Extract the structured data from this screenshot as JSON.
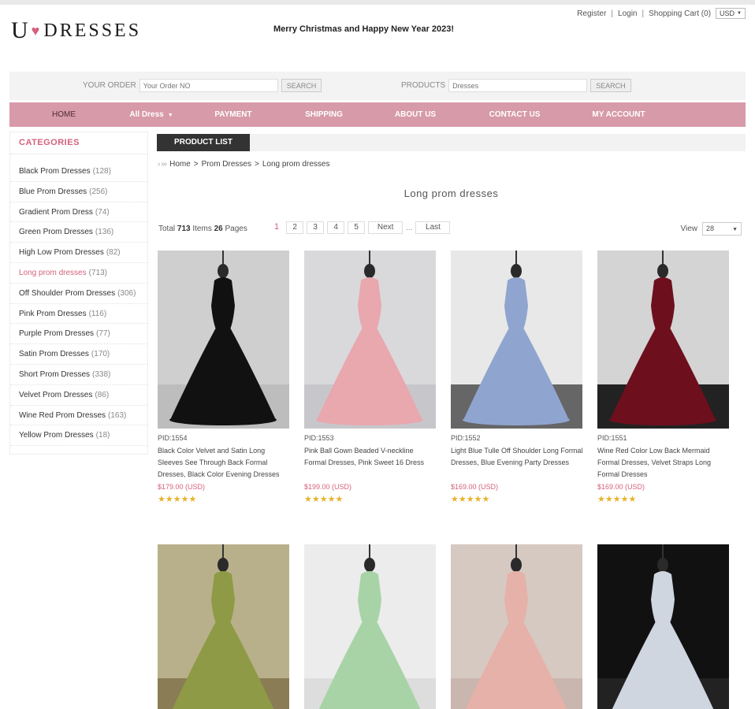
{
  "brand": {
    "logo_first": "U",
    "logo_heart": "♥",
    "logo_rest": "DRESSES"
  },
  "greeting": "Merry Christmas and Happy New Year 2023!",
  "toplinks": {
    "register": "Register",
    "login": "Login",
    "cart": "Shopping Cart (0)",
    "currency": "USD",
    "separator": "|"
  },
  "search": {
    "order_label": "YOUR ORDER",
    "order_placeholder": "Your Order NO",
    "order_button": "SEARCH",
    "products_label": "PRODUCTS",
    "products_placeholder": "Dresses",
    "products_button": "SEARCH"
  },
  "nav": [
    {
      "label": "HOME",
      "active": true
    },
    {
      "label": "All Dress",
      "dropdown": true
    },
    {
      "label": "PAYMENT"
    },
    {
      "label": "SHIPPING"
    },
    {
      "label": "ABOUT US"
    },
    {
      "label": "CONTACT US"
    },
    {
      "label": "MY ACCOUNT"
    }
  ],
  "sidebar": {
    "title": "CATEGORIES",
    "items": [
      {
        "name": "Black Prom Dresses",
        "count": "(128)"
      },
      {
        "name": "Blue Prom Dresses",
        "count": "(256)"
      },
      {
        "name": "Gradient Prom Dress",
        "count": "(74)"
      },
      {
        "name": "Green Prom Dresses",
        "count": "(136)"
      },
      {
        "name": "High Low Prom Dresses",
        "count": "(82)"
      },
      {
        "name": "Long prom dresses",
        "count": "(713)",
        "active": true
      },
      {
        "name": "Off Shoulder Prom Dresses",
        "count": "(306)"
      },
      {
        "name": "Pink Prom Dresses",
        "count": "(116)"
      },
      {
        "name": "Purple Prom Dresses",
        "count": "(77)"
      },
      {
        "name": "Satin Prom Dresses",
        "count": "(170)"
      },
      {
        "name": "Short Prom Dresses",
        "count": "(338)"
      },
      {
        "name": "Velvet Prom Dresses",
        "count": "(86)"
      },
      {
        "name": "Wine Red Prom Dresses",
        "count": "(163)"
      },
      {
        "name": "Yellow Prom Dresses",
        "count": "(18)"
      }
    ]
  },
  "tab": "PRODUCT LIST",
  "breadcrumb": {
    "arrows": "› ›››",
    "home": "Home",
    "sep": ">",
    "category": "Prom Dresses",
    "current": "Long prom dresses"
  },
  "page_title": "Long prom dresses",
  "listing": {
    "total_label": "Total",
    "total_items": "713",
    "items_label": "Items",
    "total_pages": "26",
    "pages_label": "Pages",
    "view_label": "View",
    "view_value": "28"
  },
  "pagination": {
    "current": "1",
    "pages": [
      "2",
      "3",
      "4",
      "5"
    ],
    "next": "Next",
    "dots": "...",
    "last": "Last"
  },
  "stars_text": "★★★★★",
  "products": [
    {
      "pid": "PID:1554",
      "title": "Black Color Velvet and Satin Long Sleeves See Through Back Formal Dresses, Black Color Evening Dresses",
      "price": "$179.00 (USD)",
      "dress": "#111111",
      "bg": "#cfcfcf",
      "floor": "#bdbdbd"
    },
    {
      "pid": "PID:1553",
      "title": "Pink Ball Gown Beaded V-neckline Formal Dresses, Pink Sweet 16 Dress",
      "price": "$199.00 (USD)",
      "dress": "#e9a7ae",
      "bg": "#d9d9dc",
      "floor": "#c7c7cb"
    },
    {
      "pid": "PID:1552",
      "title": "Light Blue Tulle Off Shoulder Long Formal Dresses, Blue Evening Party Dresses",
      "price": "$169.00 (USD)",
      "dress": "#8fa5cf",
      "bg": "#e8e8e8",
      "floor": "#666666"
    },
    {
      "pid": "PID:1551",
      "title": "Wine Red Color Low Back Mermaid Formal Dresses, Velvet Straps Long Formal Dresses",
      "price": "$169.00 (USD)",
      "dress": "#6e0f1e",
      "bg": "#d4d4d4",
      "floor": "#222222"
    },
    {
      "dress": "#8e9a45",
      "bg": "#b8b08a",
      "floor": "#8a7d55"
    },
    {
      "dress": "#a8d3a7",
      "bg": "#ececec",
      "floor": "#dddddd"
    },
    {
      "dress": "#e6b1a8",
      "bg": "#d6c9c2",
      "floor": "#c9b6ae"
    },
    {
      "dress": "#cfd6e0",
      "bg": "#111111",
      "floor": "#222222"
    }
  ]
}
